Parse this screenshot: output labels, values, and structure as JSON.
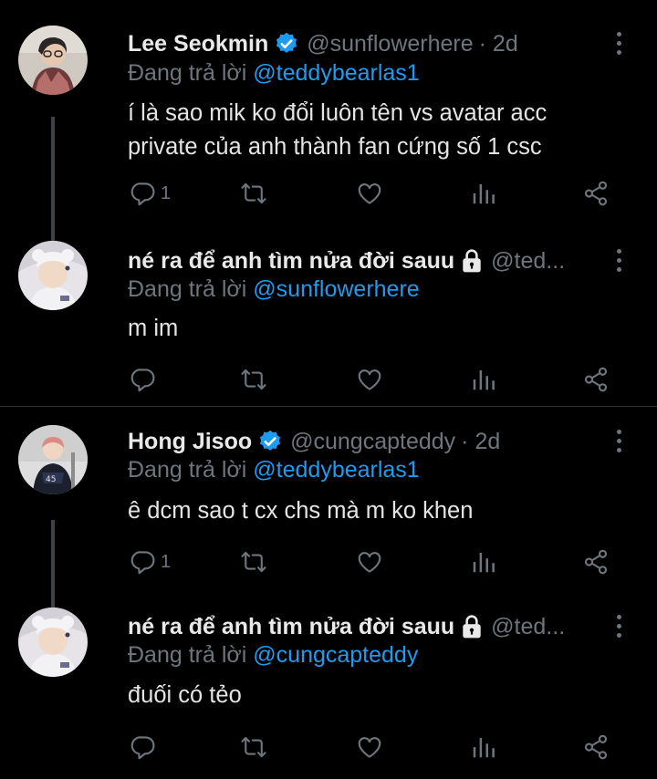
{
  "tweets": [
    {
      "name": "Lee Seokmin",
      "verified": true,
      "handle": "@sunflowerhere",
      "time": "· 2d",
      "reply_prefix": "Đang trả lời ",
      "reply_to": "@teddybearlas1",
      "text_line1": "í là sao mik ko đổi luôn tên vs avatar acc",
      "text_line2": "private của anh thành fan cứng số 1 csc",
      "reply_count": "1"
    },
    {
      "name": "né ra để anh tìm nửa đời sauu",
      "protected": true,
      "handle": "@ted...",
      "reply_prefix": "Đang trả lời ",
      "reply_to": "@sunflowerhere",
      "text": "m im"
    },
    {
      "name": "Hong Jisoo",
      "verified": true,
      "handle": "@cungcapteddy",
      "time": "· 2d",
      "reply_prefix": "Đang trả lời ",
      "reply_to": "@teddybearlas1",
      "text": "ê dcm sao t cx chs mà m ko khen",
      "reply_count": "1"
    },
    {
      "name": "né ra để anh tìm nửa đời sauu",
      "protected": true,
      "handle": "@ted...",
      "reply_prefix": "Đang trả lời ",
      "reply_to": "@cungcapteddy",
      "text": "đuối có tẻo"
    }
  ],
  "icons": [
    "reply-icon",
    "retweet-icon",
    "like-icon",
    "analytics-icon",
    "share-icon",
    "more-icon",
    "verified-badge-icon",
    "lock-icon"
  ],
  "colors": {
    "background": "#000000",
    "text": "#e4e4e4",
    "muted": "#6e767d",
    "link": "#1d9bf0",
    "verified": "#1d9bf0",
    "thread_line": "#3d4148"
  }
}
